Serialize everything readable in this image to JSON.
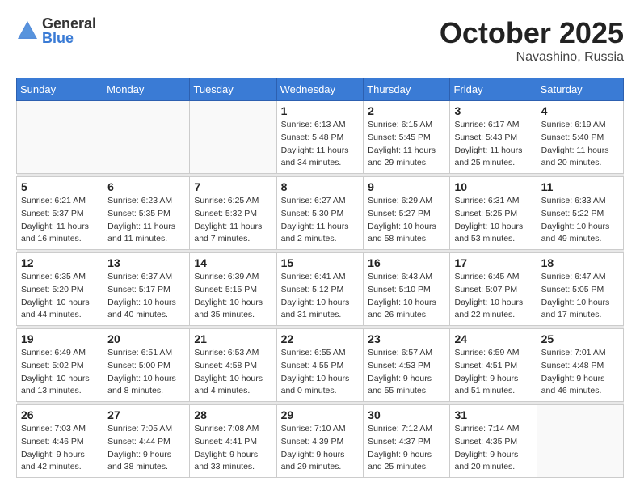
{
  "header": {
    "logo_general": "General",
    "logo_blue": "Blue",
    "month_title": "October 2025",
    "location": "Navashino, Russia"
  },
  "days_of_week": [
    "Sunday",
    "Monday",
    "Tuesday",
    "Wednesday",
    "Thursday",
    "Friday",
    "Saturday"
  ],
  "weeks": [
    [
      {
        "num": "",
        "info": ""
      },
      {
        "num": "",
        "info": ""
      },
      {
        "num": "",
        "info": ""
      },
      {
        "num": "1",
        "info": "Sunrise: 6:13 AM\nSunset: 5:48 PM\nDaylight: 11 hours\nand 34 minutes."
      },
      {
        "num": "2",
        "info": "Sunrise: 6:15 AM\nSunset: 5:45 PM\nDaylight: 11 hours\nand 29 minutes."
      },
      {
        "num": "3",
        "info": "Sunrise: 6:17 AM\nSunset: 5:43 PM\nDaylight: 11 hours\nand 25 minutes."
      },
      {
        "num": "4",
        "info": "Sunrise: 6:19 AM\nSunset: 5:40 PM\nDaylight: 11 hours\nand 20 minutes."
      }
    ],
    [
      {
        "num": "5",
        "info": "Sunrise: 6:21 AM\nSunset: 5:37 PM\nDaylight: 11 hours\nand 16 minutes."
      },
      {
        "num": "6",
        "info": "Sunrise: 6:23 AM\nSunset: 5:35 PM\nDaylight: 11 hours\nand 11 minutes."
      },
      {
        "num": "7",
        "info": "Sunrise: 6:25 AM\nSunset: 5:32 PM\nDaylight: 11 hours\nand 7 minutes."
      },
      {
        "num": "8",
        "info": "Sunrise: 6:27 AM\nSunset: 5:30 PM\nDaylight: 11 hours\nand 2 minutes."
      },
      {
        "num": "9",
        "info": "Sunrise: 6:29 AM\nSunset: 5:27 PM\nDaylight: 10 hours\nand 58 minutes."
      },
      {
        "num": "10",
        "info": "Sunrise: 6:31 AM\nSunset: 5:25 PM\nDaylight: 10 hours\nand 53 minutes."
      },
      {
        "num": "11",
        "info": "Sunrise: 6:33 AM\nSunset: 5:22 PM\nDaylight: 10 hours\nand 49 minutes."
      }
    ],
    [
      {
        "num": "12",
        "info": "Sunrise: 6:35 AM\nSunset: 5:20 PM\nDaylight: 10 hours\nand 44 minutes."
      },
      {
        "num": "13",
        "info": "Sunrise: 6:37 AM\nSunset: 5:17 PM\nDaylight: 10 hours\nand 40 minutes."
      },
      {
        "num": "14",
        "info": "Sunrise: 6:39 AM\nSunset: 5:15 PM\nDaylight: 10 hours\nand 35 minutes."
      },
      {
        "num": "15",
        "info": "Sunrise: 6:41 AM\nSunset: 5:12 PM\nDaylight: 10 hours\nand 31 minutes."
      },
      {
        "num": "16",
        "info": "Sunrise: 6:43 AM\nSunset: 5:10 PM\nDaylight: 10 hours\nand 26 minutes."
      },
      {
        "num": "17",
        "info": "Sunrise: 6:45 AM\nSunset: 5:07 PM\nDaylight: 10 hours\nand 22 minutes."
      },
      {
        "num": "18",
        "info": "Sunrise: 6:47 AM\nSunset: 5:05 PM\nDaylight: 10 hours\nand 17 minutes."
      }
    ],
    [
      {
        "num": "19",
        "info": "Sunrise: 6:49 AM\nSunset: 5:02 PM\nDaylight: 10 hours\nand 13 minutes."
      },
      {
        "num": "20",
        "info": "Sunrise: 6:51 AM\nSunset: 5:00 PM\nDaylight: 10 hours\nand 8 minutes."
      },
      {
        "num": "21",
        "info": "Sunrise: 6:53 AM\nSunset: 4:58 PM\nDaylight: 10 hours\nand 4 minutes."
      },
      {
        "num": "22",
        "info": "Sunrise: 6:55 AM\nSunset: 4:55 PM\nDaylight: 10 hours\nand 0 minutes."
      },
      {
        "num": "23",
        "info": "Sunrise: 6:57 AM\nSunset: 4:53 PM\nDaylight: 9 hours\nand 55 minutes."
      },
      {
        "num": "24",
        "info": "Sunrise: 6:59 AM\nSunset: 4:51 PM\nDaylight: 9 hours\nand 51 minutes."
      },
      {
        "num": "25",
        "info": "Sunrise: 7:01 AM\nSunset: 4:48 PM\nDaylight: 9 hours\nand 46 minutes."
      }
    ],
    [
      {
        "num": "26",
        "info": "Sunrise: 7:03 AM\nSunset: 4:46 PM\nDaylight: 9 hours\nand 42 minutes."
      },
      {
        "num": "27",
        "info": "Sunrise: 7:05 AM\nSunset: 4:44 PM\nDaylight: 9 hours\nand 38 minutes."
      },
      {
        "num": "28",
        "info": "Sunrise: 7:08 AM\nSunset: 4:41 PM\nDaylight: 9 hours\nand 33 minutes."
      },
      {
        "num": "29",
        "info": "Sunrise: 7:10 AM\nSunset: 4:39 PM\nDaylight: 9 hours\nand 29 minutes."
      },
      {
        "num": "30",
        "info": "Sunrise: 7:12 AM\nSunset: 4:37 PM\nDaylight: 9 hours\nand 25 minutes."
      },
      {
        "num": "31",
        "info": "Sunrise: 7:14 AM\nSunset: 4:35 PM\nDaylight: 9 hours\nand 20 minutes."
      },
      {
        "num": "",
        "info": ""
      }
    ]
  ]
}
